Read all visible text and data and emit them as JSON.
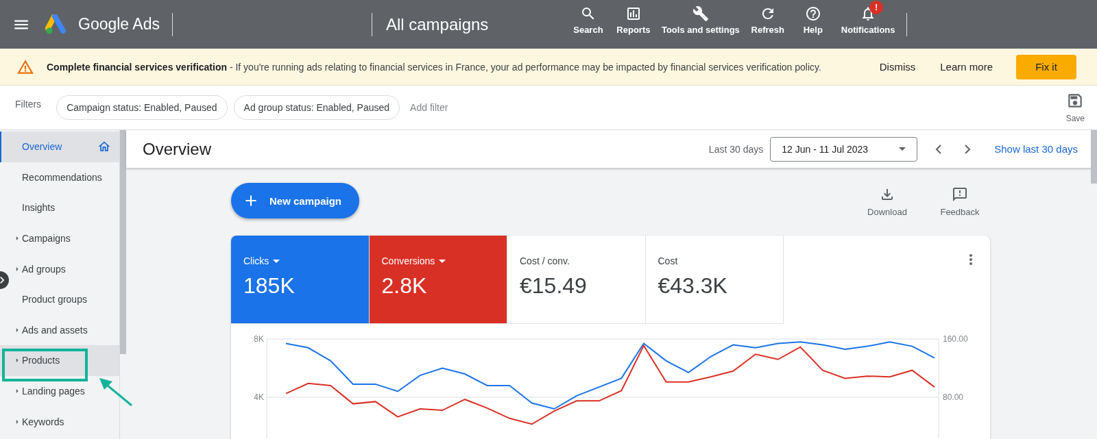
{
  "topbar": {
    "app_name": "Google Ads",
    "page_title": "All campaigns",
    "badge": "!",
    "actions": [
      {
        "kind": "search",
        "label": "Search"
      },
      {
        "kind": "reports",
        "label": "Reports"
      },
      {
        "kind": "tools",
        "label": "Tools and settings"
      },
      {
        "kind": "refresh",
        "label": "Refresh"
      },
      {
        "kind": "help",
        "label": "Help"
      },
      {
        "kind": "notifications",
        "label": "Notifications"
      }
    ]
  },
  "banner": {
    "message": "**Complete financial services verification** - If you're running ads relating to financial services in France, your ad performance may be impacted by financial services verification policy.",
    "actions": [
      "Dismiss",
      "Learn more"
    ],
    "primary": "Fix it"
  },
  "filters": {
    "label": "Filters",
    "chips": [
      "Campaign status: Enabled, Paused",
      "Ad group status: Enabled, Paused"
    ],
    "add": "Add filter",
    "save": "Save"
  },
  "sidebar": {
    "items": [
      {
        "label": "Overview",
        "selected": true,
        "hovered": false,
        "expandable": false
      },
      {
        "label": "Recommendations",
        "selected": false,
        "hovered": false,
        "expandable": false
      },
      {
        "label": "Insights",
        "selected": false,
        "hovered": false,
        "expandable": false
      },
      {
        "label": "Campaigns",
        "selected": false,
        "hovered": false,
        "expandable": true
      },
      {
        "label": "Ad groups",
        "selected": false,
        "hovered": false,
        "expandable": true
      },
      {
        "label": "Product groups",
        "selected": false,
        "hovered": false,
        "expandable": false
      },
      {
        "label": "Ads and assets",
        "selected": false,
        "hovered": false,
        "expandable": true
      },
      {
        "label": "Products",
        "selected": false,
        "hovered": true,
        "expandable": true
      },
      {
        "label": "Landing pages",
        "selected": false,
        "hovered": false,
        "expandable": true
      },
      {
        "label": "Keywords",
        "selected": false,
        "hovered": false,
        "expandable": true
      }
    ]
  },
  "header": {
    "title": "Overview",
    "range_label": "Last 30 days",
    "date_range": "12 Jun - 11 Jul 2023",
    "link": "Show last 30 days"
  },
  "new_campaign": "New campaign",
  "tools": [
    {
      "kind": "download",
      "label": "Download"
    },
    {
      "kind": "feedback",
      "label": "Feedback"
    }
  ],
  "metrics": [
    {
      "label": "Clicks",
      "value": "185K",
      "selected": true,
      "color": "#1a73e8"
    },
    {
      "label": "Conversions",
      "value": "2.8K",
      "selected": true,
      "color": "#d93025"
    },
    {
      "label": "Cost / conv.",
      "value": "€15.49",
      "selected": false
    },
    {
      "label": "Cost",
      "value": "€43.3K",
      "selected": false
    }
  ],
  "chart_data": {
    "type": "line",
    "ylim": [
      1200,
      8000
    ],
    "y2lim": [
      24,
      160
    ],
    "yticks": [
      {
        "value": 4000,
        "label": "4K"
      },
      {
        "value": 8000,
        "label": "8K"
      }
    ],
    "y2ticks": [
      {
        "value": 80,
        "label": "80.00"
      },
      {
        "value": 160,
        "label": "160.00"
      }
    ],
    "series": [
      {
        "color": "#1a73e8",
        "values": [
          7700,
          7400,
          6500,
          4900,
          4900,
          4400,
          5500,
          6000,
          5600,
          4800,
          4800,
          3600,
          3200,
          4100,
          4700,
          5300,
          7700,
          6500,
          5700,
          6800,
          7600,
          7400,
          7700,
          7800,
          7600,
          7300,
          7500,
          7800,
          7500,
          6700
        ]
      },
      {
        "color": "#d93025",
        "axis": "y2",
        "values": [
          85,
          99,
          96,
          71,
          74,
          53,
          64,
          62,
          77,
          65,
          51,
          43,
          61,
          75,
          75,
          89,
          151,
          101,
          101,
          108,
          116,
          139,
          132,
          149,
          117,
          106,
          109,
          108,
          117,
          94
        ]
      }
    ]
  }
}
